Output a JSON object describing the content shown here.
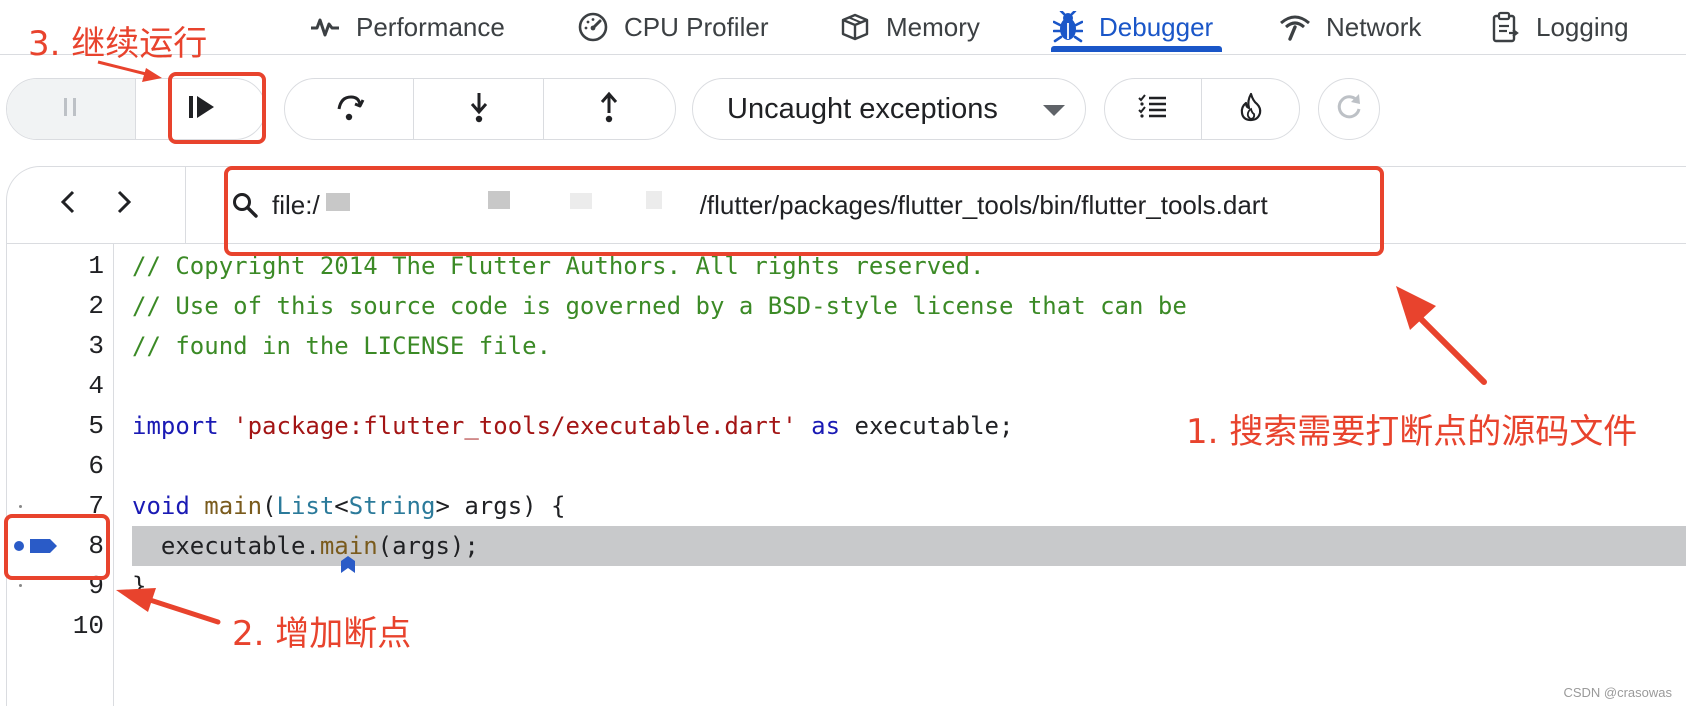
{
  "tabs": [
    {
      "label": "Performance",
      "icon": "performance-icon"
    },
    {
      "label": "CPU Profiler",
      "icon": "speedometer-icon"
    },
    {
      "label": "Memory",
      "icon": "memory-box-icon"
    },
    {
      "label": "Debugger",
      "icon": "bug-icon",
      "active": true
    },
    {
      "label": "Network",
      "icon": "network-signal-icon"
    },
    {
      "label": "Logging",
      "icon": "clipboard-log-icon"
    }
  ],
  "toolbar": {
    "pause_icon": "pause-icon",
    "resume_icon": "resume-icon",
    "step_over_icon": "step-over-icon",
    "step_in_icon": "step-in-icon",
    "step_out_icon": "step-out-icon",
    "exception_mode": "Uncaught exceptions",
    "breakpoints_icon": "breakpoint-list-icon",
    "hot_reload_icon": "hot-reload-fire-icon",
    "refresh_icon": "refresh-icon"
  },
  "file_bar": {
    "back_icon": "chevron-left-icon",
    "forward_icon": "chevron-right-icon",
    "search_icon": "search-icon",
    "path_prefix": "file:/",
    "path_suffix": "/flutter/packages/flutter_tools/bin/flutter_tools.dart"
  },
  "code": {
    "breakpoint_line": 8,
    "lines": [
      {
        "n": "1",
        "text": "// Copyright 2014 The Flutter Authors. All rights reserved."
      },
      {
        "n": "2",
        "text": "// Use of this source code is governed by a BSD-style license that can be"
      },
      {
        "n": "3",
        "text": "// found in the LICENSE file."
      },
      {
        "n": "4",
        "text": ""
      },
      {
        "n": "5",
        "text": "import 'package:flutter_tools/executable.dart' as executable;"
      },
      {
        "n": "6",
        "text": ""
      },
      {
        "n": "7",
        "text": "void main(List<String> args) {"
      },
      {
        "n": "8",
        "text": "  executable.main(args);"
      },
      {
        "n": "9",
        "text": "}"
      },
      {
        "n": "10",
        "text": ""
      }
    ]
  },
  "annotations": {
    "step1": "1. 搜索需要打断点的源码文件",
    "step2": "2. 增加断点",
    "step3": "3. 继续运行",
    "color": "#e8432d"
  },
  "watermark": "CSDN @crasowas"
}
